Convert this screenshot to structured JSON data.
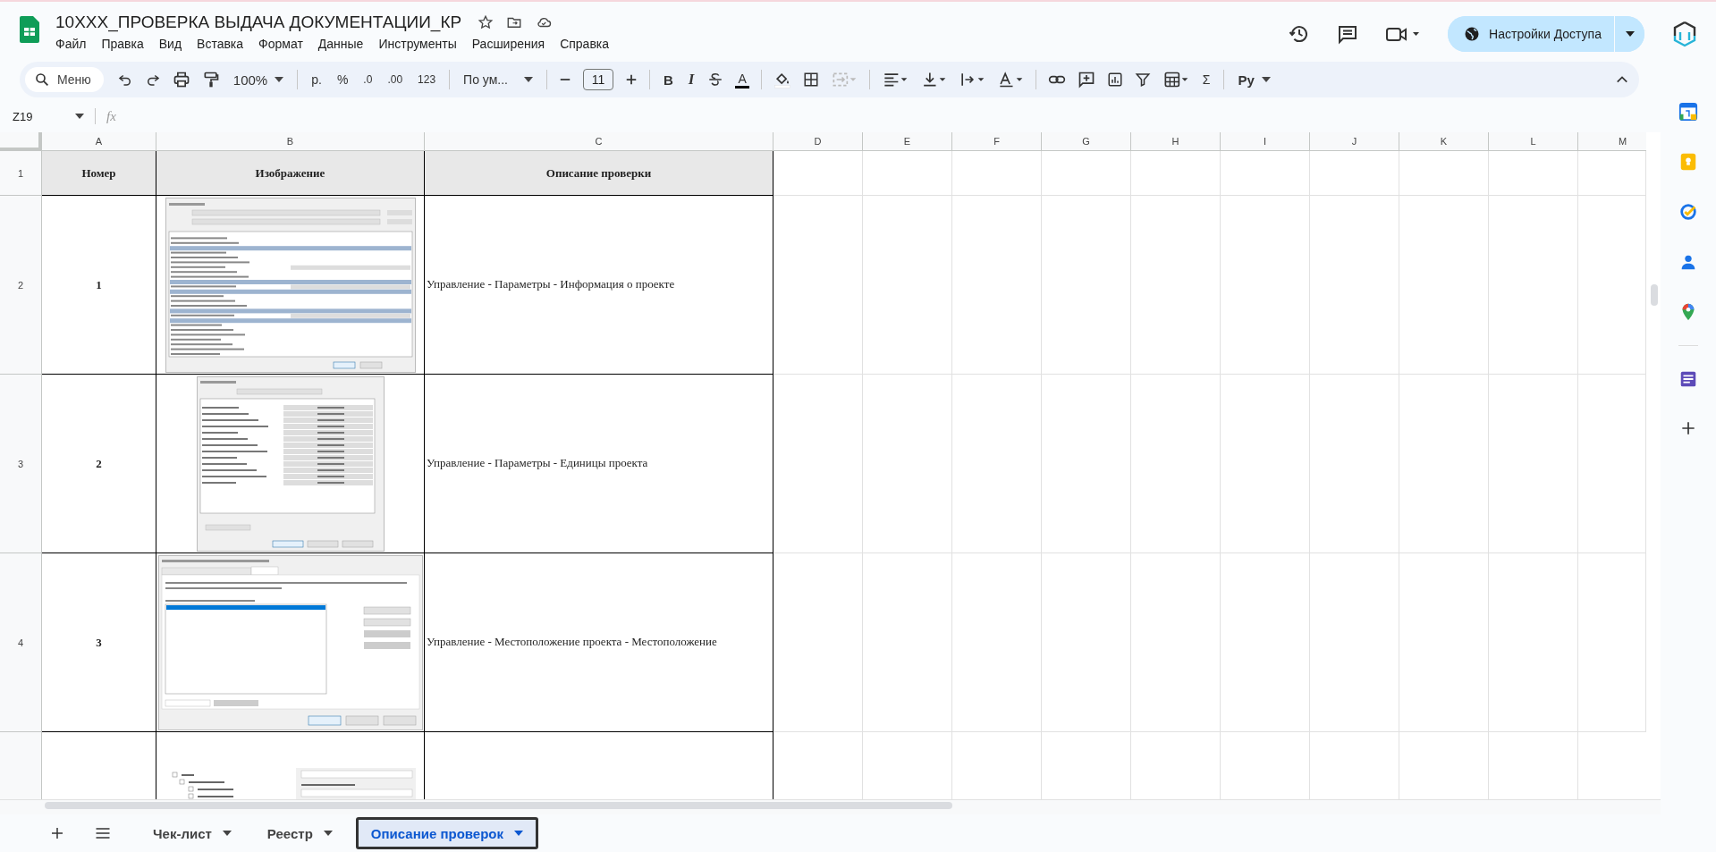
{
  "document": {
    "title": "10XXX_ПРОВЕРКА ВЫДАЧА ДОКУМЕНТАЦИИ_КР",
    "menu": [
      "Файл",
      "Правка",
      "Вид",
      "Вставка",
      "Формат",
      "Данные",
      "Инструменты",
      "Расширения",
      "Справка"
    ]
  },
  "share_button": {
    "label": "Настройки Доступа"
  },
  "toolbar": {
    "menu_search": "Меню",
    "zoom": "100%",
    "currency": "р.",
    "percent": "%",
    "decimal_decrease": ".0",
    "decimal_increase": ".00",
    "number_format": "123",
    "font": "По ум...",
    "font_size": "11",
    "bold": "B",
    "italic": "I",
    "text_color": "A",
    "sum": "Σ",
    "python": "Pу"
  },
  "formula_bar": {
    "name_box": "Z19",
    "function_label": "fx"
  },
  "columns": [
    "A",
    "B",
    "C",
    "D",
    "E",
    "F",
    "G",
    "H",
    "I",
    "J",
    "K",
    "L",
    "M"
  ],
  "rows": [
    {
      "number": "1",
      "kind": "header",
      "cells": [
        "Номер",
        "Изображение",
        "Описание проверки"
      ]
    },
    {
      "number": "2",
      "kind": "item",
      "index": "1",
      "picture": {
        "kind": "table"
      },
      "description": "Управление - Параметры - Информация о проекте"
    },
    {
      "number": "3",
      "kind": "item",
      "index": "2",
      "picture": {
        "kind": "units"
      },
      "description": "Управление - Параметры - Единицы проекта"
    },
    {
      "number": "4",
      "kind": "item",
      "index": "3",
      "picture": {
        "kind": "list"
      },
      "description": "Управление - Местоположение проекта - Местоположение"
    },
    {
      "kind": "item",
      "picture": {
        "kind": "tree"
      }
    }
  ],
  "sheet_tabs": [
    {
      "label": "Чек-лист",
      "selected": false
    },
    {
      "label": "Реестр",
      "selected": false
    },
    {
      "label": "Описание проверок",
      "selected": true
    }
  ]
}
